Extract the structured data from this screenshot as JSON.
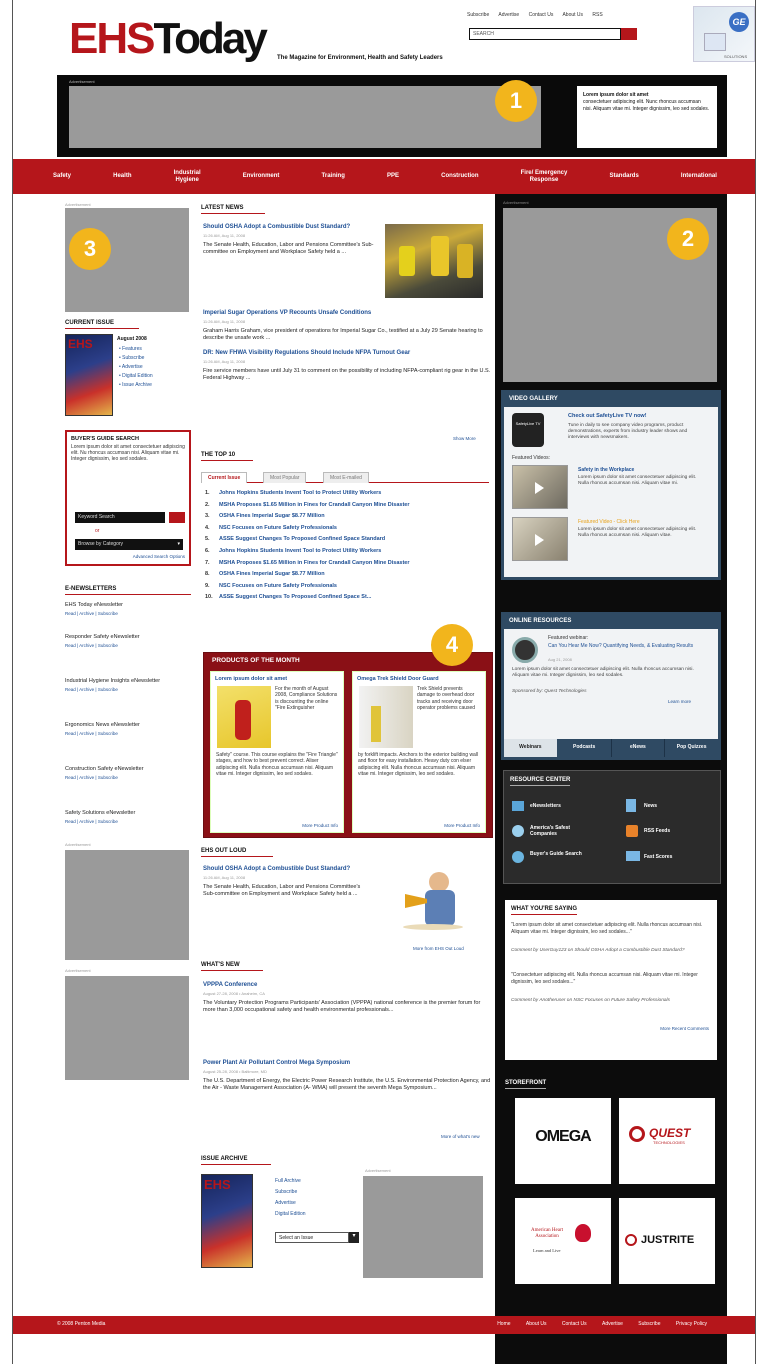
{
  "header": {
    "logo_part1": "EHS",
    "logo_part2": "Today",
    "tagline": "The Magazine for Environment, Health and Safety Leaders",
    "top_links": [
      "Subscribe",
      "Advertise",
      "Contact Us",
      "About Us",
      "RSS"
    ],
    "search_placeholder": "SEARCH",
    "sponsor_text": "SOLUTIONS"
  },
  "ad_top": {
    "label": "Advertisement",
    "text_title": "Lorem ipsum dolor sit amet",
    "text_body": "consectetuer adipiscing elit. Nunc rhoncus accumsan nisi. Aliquam vitae mi. Integer dignissim, leo sed sodales."
  },
  "nav": [
    "Safety",
    "Health",
    "Industrial\nHygiene",
    "Environment",
    "Training",
    "PPE",
    "Construction",
    "Fire/ Emergency\nResponse",
    "Standards",
    "International"
  ],
  "callouts": [
    "1",
    "2",
    "3",
    "4"
  ],
  "left": {
    "ad_label": "Advertisement",
    "current_issue_heading": "CURRENT ISSUE",
    "issue_date": "August 2008",
    "issue_links": [
      "Features",
      "Subscribe",
      "Advertise",
      "Digital Edition",
      "Issue Archive"
    ],
    "buyers": {
      "heading": "BUYER'S GUIDE SEARCH",
      "text": "Lorem ipsum dolor sit amet consectetuer adipiscing elit. Nu rhoncus accumsan nisi. Aliquam vitae mi. Integer dignissim, leo sed sodales.",
      "keyword": "Keyword Search",
      "or": "or",
      "category": "Browse by Category",
      "advanced": "Advanced Search Options"
    },
    "enews_heading": "E-NEWSLETTERS",
    "newsletters": [
      {
        "name": "EHS Today eNewsletter",
        "links": "Read | Archive | Subscribe"
      },
      {
        "name": "Responder Safety eNewsletter",
        "links": "Read | Archive | Subscribe"
      },
      {
        "name": "Industrial Hygiene Insights eNewsletter",
        "links": "Read | Archive | Subscribe"
      },
      {
        "name": "Ergonomics News eNewsletter",
        "links": "Read | Archive | Subscribe"
      },
      {
        "name": "Construction Safety eNewsletter",
        "links": "Read | Archive | Subscribe"
      },
      {
        "name": "Safety Solutions eNewsletter",
        "links": "Read | Archive | Subscribe"
      }
    ]
  },
  "middle": {
    "latest_heading": "LATEST NEWS",
    "stories": [
      {
        "title": "Should OSHA Adopt a Combustible Dust Standard?",
        "date": "11:26 AM, Aug 11, 2008",
        "text": "The Senate Health, Education, Labor and Pensions Committee's Sub-committee on Employment and Workplace Safety held a ..."
      },
      {
        "title": "Imperial Sugar Operations VP Recounts Unsafe Conditions",
        "date": "11:26 AM, Aug 11, 2008",
        "text": "Graham Harris Graham, vice president of operations for Imperial Sugar Co., testified at a July 29 Senate hearing to describe the unsafe work ..."
      },
      {
        "title": "DR: New FHWA Visibility Regulations Should Include NFPA Turnout Gear",
        "date": "11:26 AM, Aug 11, 2008",
        "text": "Fire service members have until July 31 to comment on the possibility of including NFPA-compliant rig gear in the U.S. Federal Highway ..."
      }
    ],
    "show_more": "Show More",
    "top10_heading": "THE TOP 10",
    "tabs": [
      "Current Issue",
      "Most Popular",
      "Most E-mailed"
    ],
    "top10": [
      "Johns Hopkins Students Invent Tool to Protect Utility Workers",
      "MSHA Proposes $1.65 Million in Fines for Crandall Canyon Mine Disaster",
      "OSHA Fines Imperial Sugar $8.77 Million",
      "NSC Focuses on Future Safety Professionals",
      "ASSE Suggest Changes To Proposed Confined Space Standard",
      "Johns Hopkins Students Invent Tool to Protect Utility Workers",
      "MSHA Proposes $1.65 Million in Fines for Crandall Canyon Mine Disaster",
      "OSHA Fines Imperial Sugar $8.77 Million",
      "NSC Focuses on Future Safety Professionals",
      "ASSE Suggest Changes To Proposed Confined Space St..."
    ],
    "potm": {
      "heading": "PRODUCTS OF THE MONTH",
      "cards": [
        {
          "title": "Lorem ipsum dolor sit amet",
          "text_side": "For the month of August 2008, Compliance Solutions is discounting the online \"Fire Extinguisher",
          "text_bottom": "Safety\" course. This course explains the \"Fire Triangle\" stages, and how to best prevent correct. Aliser adipiscing elit. Nulla rhoncus accumsan nisi. Aliquam vitae mi. Integer dignissim, leo sed sodales.",
          "link": "More Product Info"
        },
        {
          "title": "Omega Trek Shield Door Guard",
          "text_side": "Trek Shield prevents damage to overhead door tracks and receiving door operator problems caused",
          "text_bottom": "by forklift impacts. Anchors to the exterior building wall and floor for easy installation. Heavy duty con elser adipiscing elit. Nulla rhoncus accumsan nisi. Aliquam vitae mi. Integer dignissim, leo sed sodales.",
          "link": "More Product Info"
        }
      ]
    },
    "outloud_heading": "EHS OUT LOUD",
    "outloud": {
      "title": "Should OSHA Adopt a Combustible Dust Standard?",
      "date": "11:26 AM, Aug 11, 2008",
      "text": "The Senate Health, Education, Labor and Pensions Committee's Sub-committee on Employment and Workplace Safety held a ...",
      "more": "More from EHS Out Loud"
    },
    "whatsnew_heading": "WHAT'S NEW",
    "whatsnew": [
      {
        "title": "VPPPA Conference",
        "date": "August 27-28, 2008 • Anaheim, CA",
        "text": "The Voluntary Protection Programs Participants' Association (VPPPA) national conference is the premier forum for more than 3,000 occupational safety and health environmental professionals..."
      },
      {
        "title": "Power Plant Air Pollutant Control Mega Symposium",
        "date": "August 25-28, 2008 • Baltimore, MD",
        "text": "The U.S. Department of Energy, the Electric Power Research Institute, the U.S. Environmental Protection Agency, and the Air - Waste Management Association (A- WMA) will present the seventh Mega Symposium..."
      }
    ],
    "whatsnew_more": "More of what's new",
    "archive_heading": "ISSUE ARCHIVE",
    "archive_links": [
      "Full Archive",
      "Subscribe",
      "Advertise",
      "Digital Edition"
    ],
    "archive_select": "Select an Issue",
    "archive_ad_label": "Advertisement"
  },
  "right": {
    "ad_label": "Advertisement",
    "video": {
      "heading": "VIDEO GALLERY",
      "tv_label": "SafetyLive TV",
      "title": "Check out SafetyLive TV now!",
      "text": "Tune in daily to see company video programs, product demonstrations, experts from industry leader shows and interviews with newsmakers.",
      "featured": "Featured Videos:",
      "items": [
        {
          "title": "Safety in the Workplace",
          "text": "Lorem ipsum dolor sit amet consectetuer adipiscing elit. Nulla rhoncus accumsan nisi. Aliquam vitae mi."
        },
        {
          "title": "Featured Video - Click Here",
          "text": "Lorem ipsum dolor sit amet consectetuer adipiscing elit. Nulla rhoncus accumsan nisi. Aliquam vitae."
        }
      ]
    },
    "online": {
      "heading": "ONLINE RESOURCES",
      "feat": "Featured webinar:",
      "title": "Can You Hear Me Now? Quantifying Needs, & Evaluating Results",
      "date": "Aug 21, 2008",
      "text": "Lorem ipsum dolor sit amet consectetuer adipiscing elit. Nulla rhoncus accumsan nisi. Aliquam vitae mi. Integer dignissim, leo sed sodales.",
      "sponsor": "Sponsored by: Quest Technologies",
      "learn": "Learn more",
      "tabs": [
        "Webinars",
        "Podcasts",
        "eNews",
        "Pop Quizzes"
      ]
    },
    "resource": {
      "heading": "RESOURCE CENTER",
      "items": [
        "eNewsletters",
        "News",
        "America's Safest Companies",
        "RSS Feeds",
        "Buyer's Guide Search",
        "Fast Scores"
      ]
    },
    "saying": {
      "heading": "WHAT YOU'RE SAYING",
      "q1": "\"Lorem ipsum dolor sit amet consectetuer adipiscing elit. Nulla rhoncus accumsan nisi. Aliquam vitae mi. Integer dignissim, leo sed sodales...\"",
      "by1": "Comment by UserGuy123 on Should OSHA Adopt a Combustible Dust Standard?",
      "q2": "\"Consectetuer adipiscing elit. Nulla rhoncus accumsan nisi. Aliquam vitae mi. Integer dignissim, leo sed sodales...\"",
      "by2": "Comment by Anotheruser on NSC Focuses on Future Safety Professionals",
      "more": "More Recent Comments"
    },
    "storefront_heading": "STOREFRONT",
    "stores": [
      "OMEGA",
      "QUEST",
      "American Heart Association",
      "JUSTRITE"
    ],
    "quest_sub": "TECHNOLOGIES",
    "aha_sub": "Learn and Live"
  },
  "footer": {
    "copyright": "© 2008 Penton Media",
    "links": [
      "Home",
      "About Us",
      "Contact Us",
      "Advertise",
      "Subscribe",
      "Privacy Policy"
    ]
  },
  "colors": {
    "brand_red": "#b5161b",
    "link_blue": "#1e4f94",
    "dark_panel": "#0c0c0c",
    "accent_gold": "#f2b51c"
  }
}
